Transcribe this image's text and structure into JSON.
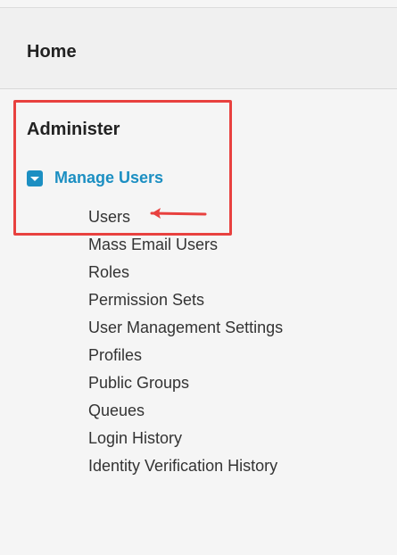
{
  "nav": {
    "home_label": "Home",
    "section_title": "Administer",
    "group_label": "Manage Users",
    "items": [
      {
        "label": "Users"
      },
      {
        "label": "Mass Email Users"
      },
      {
        "label": "Roles"
      },
      {
        "label": "Permission Sets"
      },
      {
        "label": "User Management Settings"
      },
      {
        "label": "Profiles"
      },
      {
        "label": "Public Groups"
      },
      {
        "label": "Queues"
      },
      {
        "label": "Login History"
      },
      {
        "label": "Identity Verification History"
      }
    ]
  },
  "colors": {
    "link_blue": "#1c8fc2",
    "highlight_red": "#e8413f"
  }
}
